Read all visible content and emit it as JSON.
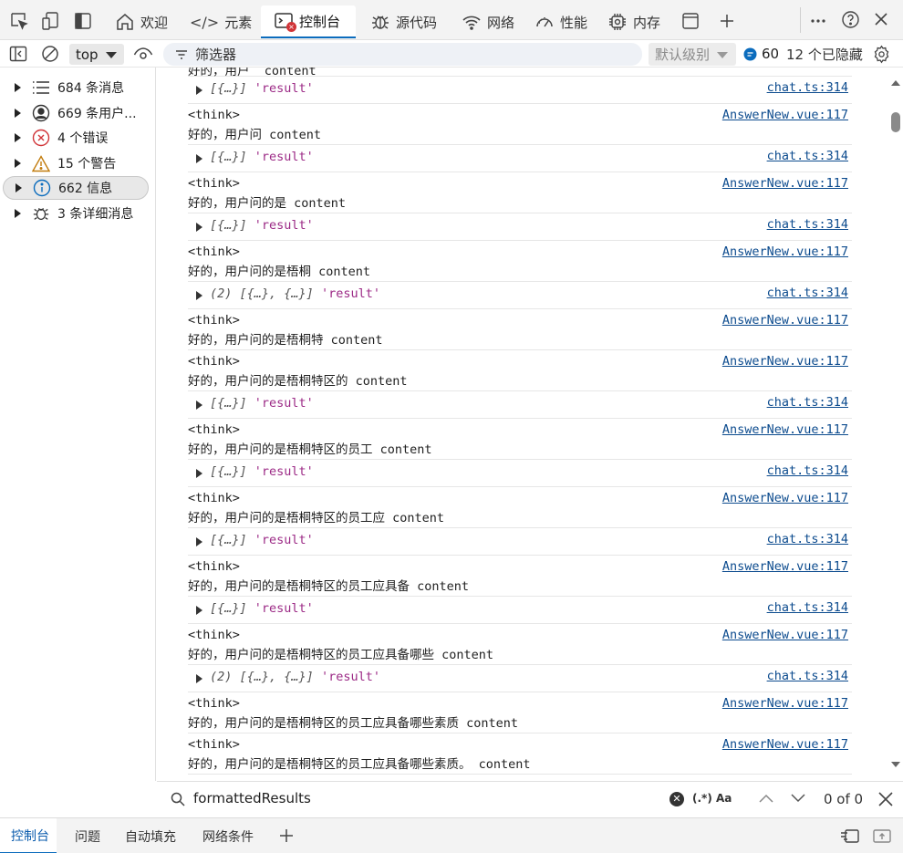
{
  "tabs": [
    {
      "label": "欢迎",
      "icon": "home-icon"
    },
    {
      "label": "元素",
      "icon": "code-icon"
    },
    {
      "label": "控制台",
      "icon": "console-icon"
    },
    {
      "label": "源代码",
      "icon": "bug-icon"
    },
    {
      "label": "网络",
      "icon": "wifi-icon"
    },
    {
      "label": "性能",
      "icon": "gauge-icon"
    },
    {
      "label": "内存",
      "icon": "chip-icon"
    }
  ],
  "toolbar": {
    "context": "top",
    "filter_placeholder": "筛选器",
    "level": "默认级别",
    "issue_count": "60",
    "hidden": "12 个已隐藏"
  },
  "sidebar": {
    "items": [
      {
        "label": "684 条消息",
        "icon": "list-icon"
      },
      {
        "label": "669 条用户...",
        "icon": "user-icon"
      },
      {
        "label": "4 个错误",
        "icon": "error-icon"
      },
      {
        "label": "15 个警告",
        "icon": "warning-icon"
      },
      {
        "label": "662 信息",
        "icon": "info-icon"
      },
      {
        "label": "3 条详细消息",
        "icon": "bug-icon"
      }
    ]
  },
  "console": {
    "partial_top": "好的，用户  content",
    "rows": [
      {
        "type": "obj",
        "prefix": "",
        "obj": "[{…}]",
        "str": "'result'",
        "src": "chat.ts:314"
      },
      {
        "type": "log",
        "l1": "<think>",
        "l2": "好的，用户问 content",
        "src": "AnswerNew.vue:117"
      },
      {
        "type": "obj",
        "prefix": "",
        "obj": "[{…}]",
        "str": "'result'",
        "src": "chat.ts:314"
      },
      {
        "type": "log",
        "l1": "<think>",
        "l2": "好的，用户问的是 content",
        "src": "AnswerNew.vue:117"
      },
      {
        "type": "obj",
        "prefix": "",
        "obj": "[{…}]",
        "str": "'result'",
        "src": "chat.ts:314"
      },
      {
        "type": "log",
        "l1": "<think>",
        "l2": "好的，用户问的是梧桐 content",
        "src": "AnswerNew.vue:117"
      },
      {
        "type": "obj",
        "prefix": "(2) ",
        "obj": "[{…}, {…}]",
        "str": "'result'",
        "src": "chat.ts:314"
      },
      {
        "type": "log",
        "l1": "<think>",
        "l2": "好的，用户问的是梧桐特 content",
        "src": "AnswerNew.vue:117"
      },
      {
        "type": "log",
        "l1": "<think>",
        "l2": "好的，用户问的是梧桐特区的 content",
        "src": "AnswerNew.vue:117"
      },
      {
        "type": "obj",
        "prefix": "",
        "obj": "[{…}]",
        "str": "'result'",
        "src": "chat.ts:314"
      },
      {
        "type": "log",
        "l1": "<think>",
        "l2": "好的，用户问的是梧桐特区的员工 content",
        "src": "AnswerNew.vue:117"
      },
      {
        "type": "obj",
        "prefix": "",
        "obj": "[{…}]",
        "str": "'result'",
        "src": "chat.ts:314"
      },
      {
        "type": "log",
        "l1": "<think>",
        "l2": "好的，用户问的是梧桐特区的员工应 content",
        "src": "AnswerNew.vue:117"
      },
      {
        "type": "obj",
        "prefix": "",
        "obj": "[{…}]",
        "str": "'result'",
        "src": "chat.ts:314"
      },
      {
        "type": "log",
        "l1": "<think>",
        "l2": "好的，用户问的是梧桐特区的员工应具备 content",
        "src": "AnswerNew.vue:117"
      },
      {
        "type": "obj",
        "prefix": "",
        "obj": "[{…}]",
        "str": "'result'",
        "src": "chat.ts:314"
      },
      {
        "type": "log",
        "l1": "<think>",
        "l2": "好的，用户问的是梧桐特区的员工应具备哪些 content",
        "src": "AnswerNew.vue:117"
      },
      {
        "type": "obj",
        "prefix": "(2) ",
        "obj": "[{…}, {…}]",
        "str": "'result'",
        "src": "chat.ts:314"
      },
      {
        "type": "log",
        "l1": "<think>",
        "l2": "好的，用户问的是梧桐特区的员工应具备哪些素质 content",
        "src": "AnswerNew.vue:117"
      },
      {
        "type": "log",
        "l1": "<think>",
        "l2": "好的，用户问的是梧桐特区的员工应具备哪些素质。 content",
        "src": "AnswerNew.vue:117"
      }
    ]
  },
  "find": {
    "query": "formattedResults",
    "regex": "(.*)",
    "case": "Aa",
    "count": "0 of 0"
  },
  "bottom_tabs": [
    "控制台",
    "问题",
    "自动填充",
    "网络条件"
  ],
  "colors": {
    "accent": "#0b6cbd",
    "link": "#0c4b8e",
    "string": "#9c2a86",
    "error": "#d13438",
    "warning": "#c27c0e",
    "info": "#0b6cbd"
  }
}
